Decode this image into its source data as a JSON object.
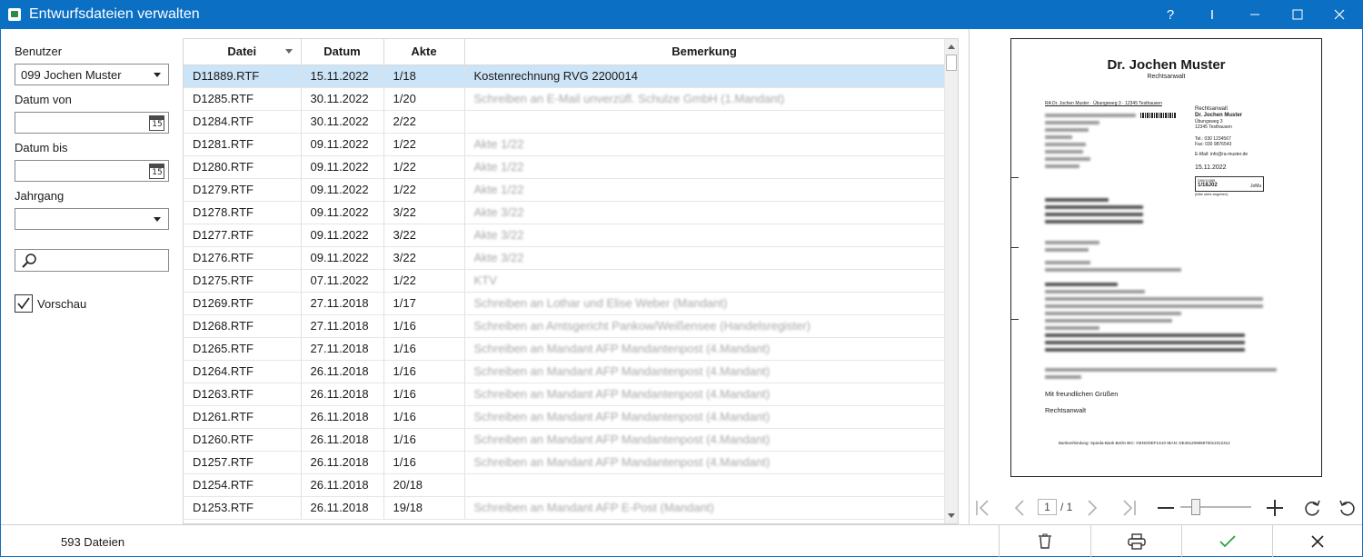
{
  "window": {
    "title": "Entwurfsdateien verwalten",
    "controls": [
      "?",
      "I"
    ]
  },
  "filters": {
    "benutzer_label": "Benutzer",
    "benutzer_value": "099 Jochen Muster",
    "datum_von_label": "Datum von",
    "datum_bis_label": "Datum bis",
    "calendar_day": "15",
    "jahrgang_label": "Jahrgang",
    "vorschau_label": "Vorschau"
  },
  "table": {
    "columns": [
      "Datei",
      "Datum",
      "Akte",
      "Bemerkung"
    ],
    "rows": [
      {
        "datei": "D11889.RTF",
        "datum": "15.11.2022",
        "akte": "1/18",
        "bemerkung": "Kostenrechnung RVG 2200014"
      },
      {
        "datei": "D1285.RTF",
        "datum": "30.11.2022",
        "akte": "1/20",
        "bemerkung": "Schreiben an E-Mail unverzüfl. Schulze GmbH (1.Mandant)"
      },
      {
        "datei": "D1284.RTF",
        "datum": "30.11.2022",
        "akte": "2/22",
        "bemerkung": ""
      },
      {
        "datei": "D1281.RTF",
        "datum": "09.11.2022",
        "akte": "1/22",
        "bemerkung": "Akte 1/22"
      },
      {
        "datei": "D1280.RTF",
        "datum": "09.11.2022",
        "akte": "1/22",
        "bemerkung": "Akte 1/22"
      },
      {
        "datei": "D1279.RTF",
        "datum": "09.11.2022",
        "akte": "1/22",
        "bemerkung": "Akte 1/22"
      },
      {
        "datei": "D1278.RTF",
        "datum": "09.11.2022",
        "akte": "3/22",
        "bemerkung": "Akte 3/22"
      },
      {
        "datei": "D1277.RTF",
        "datum": "09.11.2022",
        "akte": "3/22",
        "bemerkung": "Akte 3/22"
      },
      {
        "datei": "D1276.RTF",
        "datum": "09.11.2022",
        "akte": "3/22",
        "bemerkung": "Akte 3/22"
      },
      {
        "datei": "D1275.RTF",
        "datum": "07.11.2022",
        "akte": "1/22",
        "bemerkung": "KTV"
      },
      {
        "datei": "D1269.RTF",
        "datum": "27.11.2018",
        "akte": "1/17",
        "bemerkung": "Schreiben an Lothar und Elise Weber (Mandant)"
      },
      {
        "datei": "D1268.RTF",
        "datum": "27.11.2018",
        "akte": "1/16",
        "bemerkung": "Schreiben an Amtsgericht Pankow/Weißensee (Handelsregister)"
      },
      {
        "datei": "D1265.RTF",
        "datum": "27.11.2018",
        "akte": "1/16",
        "bemerkung": "Schreiben an Mandant AFP Mandantenpost (4.Mandant)"
      },
      {
        "datei": "D1264.RTF",
        "datum": "26.11.2018",
        "akte": "1/16",
        "bemerkung": "Schreiben an Mandant AFP Mandantenpost (4.Mandant)"
      },
      {
        "datei": "D1263.RTF",
        "datum": "26.11.2018",
        "akte": "1/16",
        "bemerkung": "Schreiben an Mandant AFP Mandantenpost (4.Mandant)"
      },
      {
        "datei": "D1261.RTF",
        "datum": "26.11.2018",
        "akte": "1/16",
        "bemerkung": "Schreiben an Mandant AFP Mandantenpost (4.Mandant)"
      },
      {
        "datei": "D1260.RTF",
        "datum": "26.11.2018",
        "akte": "1/16",
        "bemerkung": "Schreiben an Mandant AFP Mandantenpost (4.Mandant)"
      },
      {
        "datei": "D1257.RTF",
        "datum": "26.11.2018",
        "akte": "1/16",
        "bemerkung": "Schreiben an Mandant AFP Mandantenpost (4.Mandant)"
      },
      {
        "datei": "D1254.RTF",
        "datum": "26.11.2018",
        "akte": "20/18",
        "bemerkung": ""
      },
      {
        "datei": "D1253.RTF",
        "datum": "26.11.2018",
        "akte": "19/18",
        "bemerkung": "Schreiben an Mandant AFP E-Post (Mandant)"
      }
    ]
  },
  "preview": {
    "doc_title": "Dr. Jochen Muster",
    "doc_subtitle": "Rechtsanwalt",
    "sender_line": "RA Dr. Jochen Muster · Übungsweg 3 · 12345 Testhausen",
    "contact_role": "Rechtsanwalt",
    "contact_name": "Dr. Jochen Muster",
    "contact_street": "Übungsweg 3",
    "contact_city": "12345 Testhausen",
    "tel": "Tel.:       030 1234567",
    "fax": "Fax:       030 9876543",
    "email": "E-Mail:   info@ra-muster.de",
    "date": "15.11.2022",
    "ref_label": "D99/11889",
    "ref_value": "1/18J02",
    "ref_initials": "JoMu",
    "ref_note": "(bitte stets angeben)",
    "greeting": "Mit freundlichen Grüßen",
    "signoff": "Rechtsanwalt",
    "footer": "Bankverbindung:      Sparda-Bank Berlin      BIC: GENODEF1S10      IBAN: DE46120965970012312312",
    "current_page": "1",
    "total_pages": "/ 1"
  },
  "status": {
    "count_text": "593 Dateien"
  },
  "colors": {
    "titlebar": "#0b6fc4",
    "selected_row": "#cce4f7",
    "confirm": "#2ea043"
  }
}
